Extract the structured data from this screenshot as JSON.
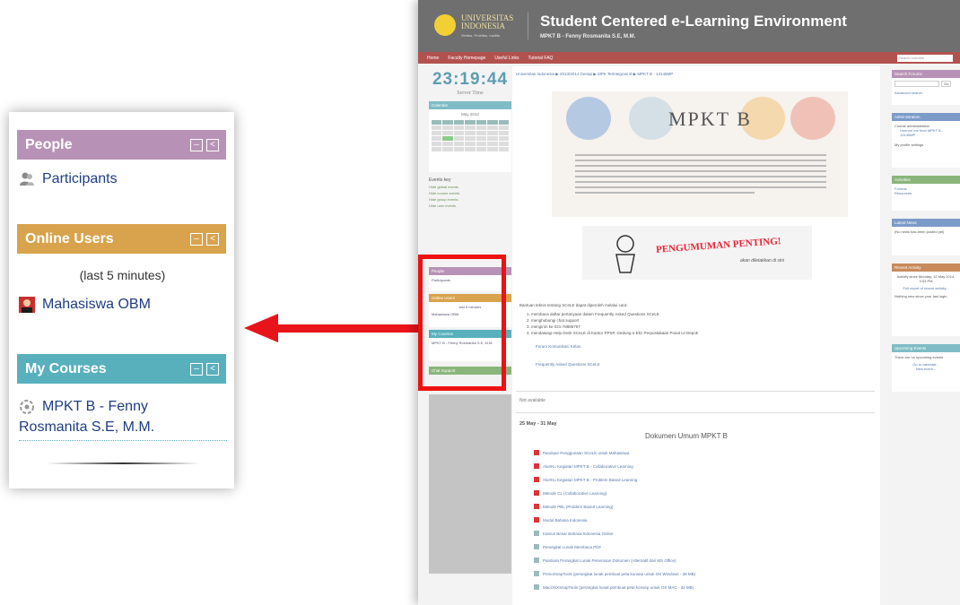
{
  "zoom": {
    "people": {
      "title": "People",
      "participants_label": "Participants"
    },
    "online_users": {
      "title": "Online Users",
      "window_label": "(last 5 minutes)",
      "user_name": "Mahasiswa OBM"
    },
    "my_courses": {
      "title": "My Courses",
      "course_line1": "MPKT B - Fenny",
      "course_line2": "Rosmanita S.E, M.M."
    },
    "ctrl_hide_glyph": "–",
    "ctrl_dock_glyph": "<"
  },
  "colors": {
    "people_header": "#b892b6",
    "online_header": "#d8a34c",
    "courses_header": "#58b0bd",
    "arrow": "#e8141a",
    "banner": "#6f6f6f",
    "nav": "#b2524f"
  },
  "screenshot": {
    "banner": {
      "university_line1": "UNIVERSITAS",
      "university_line2": "INDONESIA",
      "university_motto": "Veritas, Probitas, Iustitia",
      "title": "Student Centered e-Learning Environment",
      "subtitle": "MPKT B - Fenny Rosmanita S.E, M.M."
    },
    "nav": {
      "items": [
        "Home",
        "Faculty Homepage",
        "Useful Links",
        "Tutorial FAQ"
      ],
      "search_placeholder": "Search courses"
    },
    "clock": {
      "time": "23:19:44",
      "label": "Server Time"
    },
    "breadcrumb": "Universitas Indonesia ▶ 2013/2014 Genap ▶ MPK Terintegrasi B ▶ MPKT B - 13145MP",
    "left": {
      "calendar_title": "Calendar",
      "month": "May 2014",
      "events_key": "Events key",
      "events": [
        "Hide global events",
        "Hide course events",
        "Hide group events",
        "Hide user events"
      ],
      "people_title": "People",
      "participants": "Participants",
      "online_title": "Online Users",
      "online_window": "last 5 minutes",
      "online_user": "Mahasiswa OBM",
      "courses_title": "My Courses",
      "course_name": "MPKT B - Fenny Rosmanita S.E, M.M.",
      "support_title": "Chat Support"
    },
    "main": {
      "mpkt_title": "MPKT B",
      "announcement": "PENGUMUMAN PENTING!",
      "announcement_sub": "akan diletakkan di sini",
      "help_intro": "Bantuan teknis tentang SCeLE dapat diperoleh melalui cara:",
      "help_items": [
        "1. membaca daftar pertanyaan dalam Frequently Asked Questions SCeLE",
        "2. menghubungi chat support",
        "3. mengirim ke 021-78886797",
        "4. mendatangi Help Desk SCeLE di Kantor PPSP, Gedung e-Ekz Perpustakaan Pusat UI Depok"
      ],
      "forum_link": "Forum Komunikasi Kelas",
      "faq_link": "Frequently Asked Questions SCeLE",
      "not_available": "Not available",
      "week": "25 May - 31 May",
      "dokumen_title": "Dokumen Umum MPKT B",
      "documents": [
        "Panduan Penggunaan SCeLE untuk Mahasiswa",
        "Alur/Ku Kegiatan MPKT B - Collaborative Learning",
        "Alur/Ku Kegiatan MPKT B - Problem Based Learning",
        "Metode CL (Collaborative Learning)",
        "Metode PBL (Problem Based Learning)",
        "Modul Bahasa Indonesia",
        "Kamus Besar Bahasa Indonesia Online",
        "Perangkat Lunak Membaca PDF",
        "Panduan Perangkat Lunak Penerusan Dokumen (Alternatif dari MS Office)",
        "PrimoSnapTools (perangkat lunak pembuat peta konsep untuk OS Windows - 38 MB)",
        "MacOSXSnapTools (perangkat lunak pembuat peta konsep untuk OS MAC - 32 MB)"
      ]
    },
    "right": {
      "search_title": "Search Forums",
      "go": "Go",
      "advanced": "Advanced search",
      "admin_title": "Administration",
      "admin_items": [
        "Course administration",
        "Unenrol me from MPKT B - 13145MP",
        "My profile settings"
      ],
      "activities_title": "Activities",
      "activities": [
        "Forums",
        "Resources"
      ],
      "news_title": "Latest News",
      "news_text": "(No news has been posted yet)",
      "recent_title": "Recent Activity",
      "recent_text": "Activity since Monday, 12 May 2014, 3:53 PM",
      "recent_link": "Full report of recent activity...",
      "recent_none": "Nothing new since your last login",
      "upcoming_title": "Upcoming Events",
      "upcoming_text": "There are no upcoming events",
      "calendar_link": "Go to calendar...",
      "new_event": "New event..."
    }
  }
}
